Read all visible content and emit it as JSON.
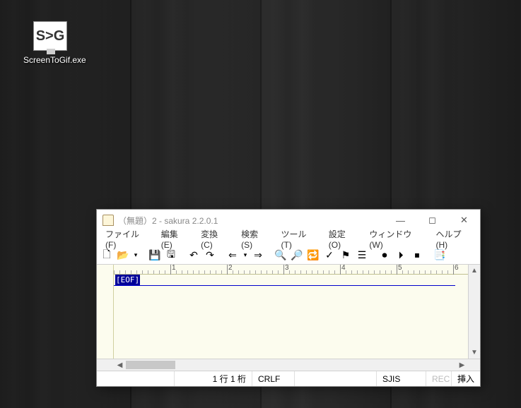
{
  "desktop": {
    "icon_glyph": "S>G",
    "icon_label": "ScreenToGif.exe"
  },
  "window": {
    "title": "（無題）2 - sakura 2.2.0.1",
    "controls": {
      "min": "—",
      "max": "◻",
      "close": "✕"
    }
  },
  "menu": {
    "file": "ファイル(F)",
    "edit": "編集(E)",
    "convert": "変換(C)",
    "search": "検索(S)",
    "tools": "ツール(T)",
    "settings": "設定(O)",
    "window": "ウィンドウ(W)",
    "help": "ヘルプ(H)"
  },
  "toolbar": {
    "new": "🗋",
    "open": "📂",
    "open_dd": "▾",
    "save": "💾",
    "saveall": "🖫",
    "undo": "↶",
    "redo": "↷",
    "back": "⇐",
    "back_dd": "▾",
    "fwd": "⇒",
    "find": "🔍",
    "find_next": "🔎",
    "replace": "🔁",
    "mark": "✓",
    "mark2": "⚑",
    "outline": "☰",
    "rec1": "⏺",
    "rec2": "⏵",
    "rec3": "⏹",
    "typeset": "📑"
  },
  "ruler": {
    "labels": [
      "1",
      "2",
      "3",
      "4",
      "5",
      "6"
    ]
  },
  "editor": {
    "eof": "[EOF]"
  },
  "status": {
    "pos": "1 行   1 桁",
    "newline": "CRLF",
    "encoding": "SJIS",
    "rec": "REC",
    "insert": "挿入"
  }
}
